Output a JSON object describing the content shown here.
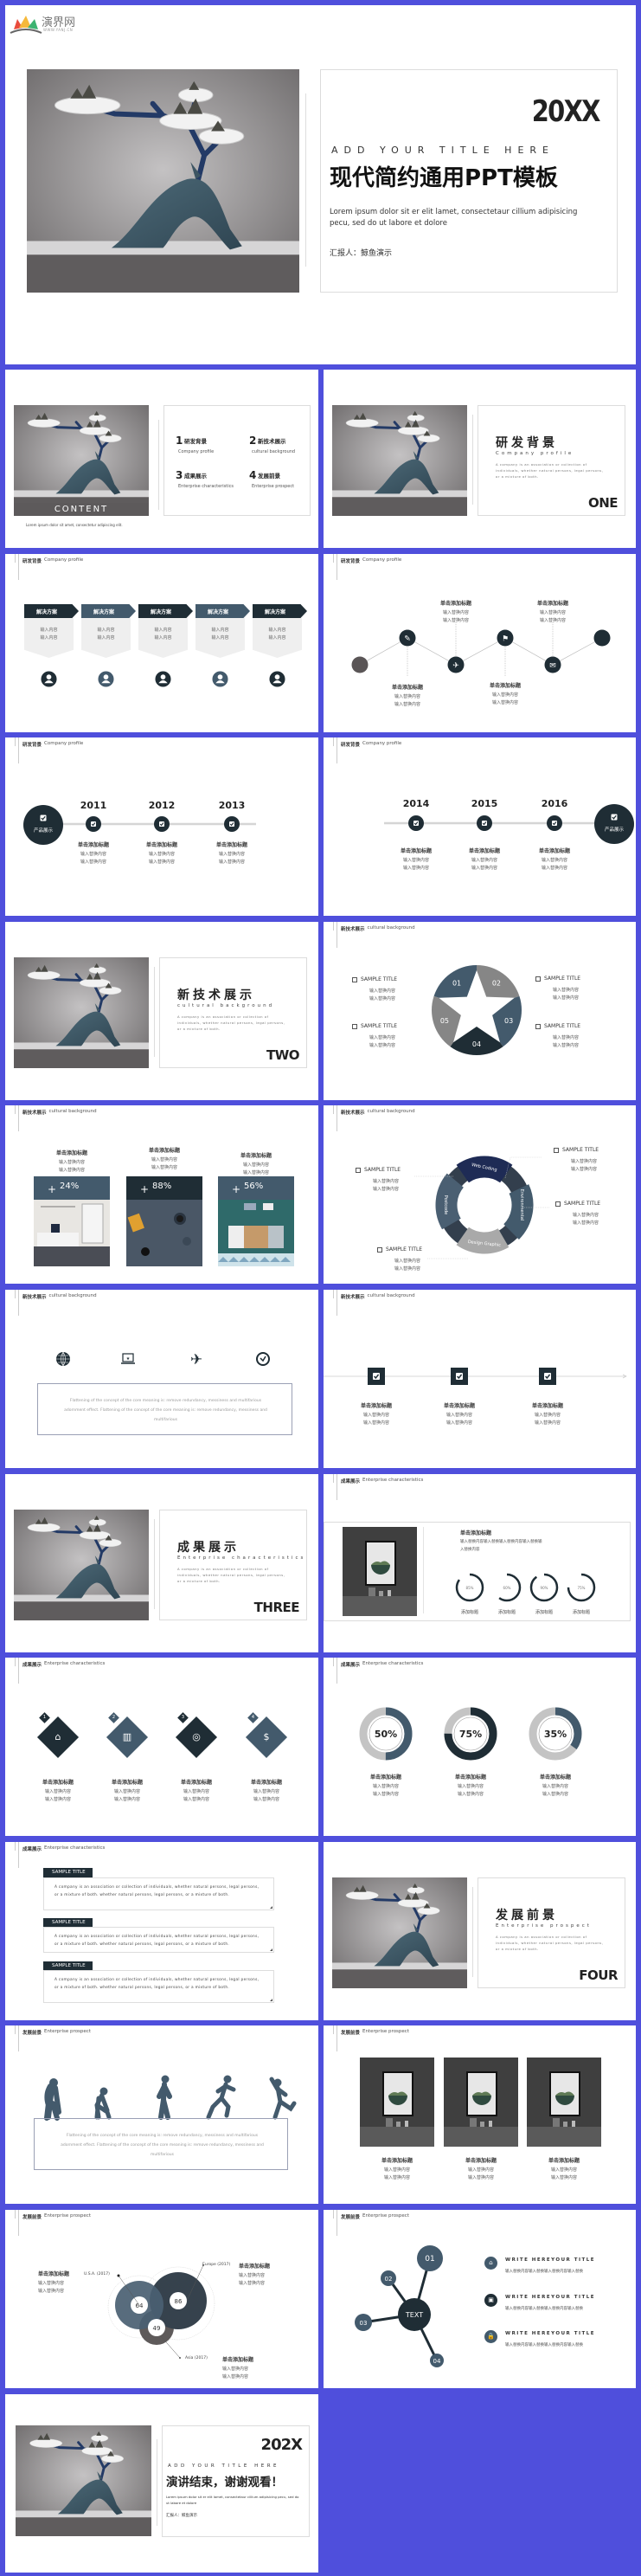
{
  "colors": {
    "background": "#4f4fdc",
    "dark": "#1f2d35",
    "slate": "#435a6c",
    "gray": "#8a8a8a",
    "light": "#efefef"
  },
  "brand": {
    "logo_text": "演界网",
    "logo_sub": "WWW.YANJ.CN"
  },
  "cover": {
    "year": "20XX",
    "en_title": "ADD YOUR TITLE HERE",
    "title": "现代简约通用PPT模板",
    "lorem": "Lorem ipsum dolor sit er elit lamet, consectetaur cillium adipisicing pecu, sed do ut labore et dolore",
    "reporter": "汇报人：鲸鱼演示"
  },
  "slides": [
    {
      "type": "contents",
      "image_caption": "CONTENT",
      "lorem": "Lorem ipsum dolor sit amet, consectetur adipiscing elit.",
      "items": [
        {
          "num": "1",
          "title": "研发背景",
          "sub": "Company profile"
        },
        {
          "num": "2",
          "title": "新技术展示",
          "sub": "cultural background"
        },
        {
          "num": "3",
          "title": "成果展示",
          "sub": "Enterprise characteristics"
        },
        {
          "num": "4",
          "title": "发展前景",
          "sub": "Enterprise prospect"
        }
      ]
    },
    {
      "type": "section",
      "title": "研发背景",
      "subtitle": "Company profile",
      "desc": "A company is an association or collection of individuals, whether natural persons, legal persons, or a mixture of both.",
      "number": "ONE"
    },
    {
      "type": "arrows",
      "header": "研发背景",
      "header_en": "Company profile",
      "boxes": [
        {
          "label": "解决方案",
          "lines": [
            "输入内容",
            "输入内容"
          ]
        },
        {
          "label": "解决方案",
          "lines": [
            "输入内容",
            "输入内容"
          ]
        },
        {
          "label": "解决方案",
          "lines": [
            "输入内容",
            "输入内容"
          ]
        },
        {
          "label": "解决方案",
          "lines": [
            "输入内容",
            "输入内容"
          ]
        },
        {
          "label": "解决方案",
          "lines": [
            "输入内容",
            "输入内容"
          ]
        }
      ]
    },
    {
      "type": "zigzag",
      "header": "研发背景",
      "header_en": "Company profile",
      "icons": [
        "circle",
        "tools-icon",
        "plane-icon",
        "signpost-icon",
        "rocket-icon",
        "circle"
      ],
      "items": [
        {
          "title": "单击添加标题",
          "lines": [
            "输入替换内容",
            "输入替换内容"
          ]
        },
        {
          "title": "单击添加标题",
          "lines": [
            "输入替换内容",
            "输入替换内容"
          ]
        },
        {
          "title": "单击添加标题",
          "lines": [
            "输入替换内容",
            "输入替换内容"
          ]
        },
        {
          "title": "单击添加标题",
          "lines": [
            "输入替换内容",
            "输入替换内容"
          ]
        }
      ]
    },
    {
      "type": "timeline",
      "header": "研发背景",
      "header_en": "Company profile",
      "center_label": "产品展示",
      "side": "left",
      "items": [
        {
          "year": "2011",
          "title": "单击添加标题",
          "lines": [
            "输入替换内容",
            "输入替换内容"
          ]
        },
        {
          "year": "2012",
          "title": "单击添加标题",
          "lines": [
            "输入替换内容",
            "输入替换内容"
          ]
        },
        {
          "year": "2013",
          "title": "单击添加标题",
          "lines": [
            "输入替换内容",
            "输入替换内容"
          ]
        }
      ]
    },
    {
      "type": "timeline",
      "header": "研发背景",
      "header_en": "Company profile",
      "center_label": "产品展示",
      "side": "right",
      "items": [
        {
          "year": "2014",
          "title": "单击添加标题",
          "lines": [
            "输入替换内容",
            "输入替换内容"
          ]
        },
        {
          "year": "2015",
          "title": "单击添加标题",
          "lines": [
            "输入替换内容",
            "输入替换内容"
          ]
        },
        {
          "year": "2016",
          "title": "单击添加标题",
          "lines": [
            "输入替换内容",
            "输入替换内容"
          ]
        }
      ]
    },
    {
      "type": "section",
      "title": "新技术展示",
      "subtitle": "cultural background",
      "desc": "A company is an association or collection of individuals, whether natural persons, legal persons, or a mixture of both.",
      "number": "TWO"
    },
    {
      "type": "star",
      "header": "新技术展示",
      "header_en": "cultural background",
      "segments": [
        "01",
        "02",
        "03",
        "04",
        "05"
      ],
      "items": [
        {
          "title": "SAMPLE TITLE",
          "lines": [
            "输入替换内容",
            "输入替换内容"
          ]
        },
        {
          "title": "SAMPLE TITLE",
          "lines": [
            "输入替换内容",
            "输入替换内容"
          ]
        },
        {
          "title": "SAMPLE TITLE",
          "lines": [
            "输入替换内容",
            "输入替换内容"
          ]
        },
        {
          "title": "SAMPLE TITLE",
          "lines": [
            "输入替换内容",
            "输入替换内容"
          ]
        }
      ]
    },
    {
      "type": "photos",
      "header": "新技术展示",
      "header_en": "cultural background",
      "items": [
        {
          "title": "单击添加标题",
          "lines": [
            "输入替换内容",
            "输入替换内容"
          ],
          "value": "24%"
        },
        {
          "title": "单击添加标题",
          "lines": [
            "输入替换内容",
            "输入替换内容"
          ],
          "value": "88%"
        },
        {
          "title": "单击添加标题",
          "lines": [
            "输入替换内容",
            "输入替换内容"
          ],
          "value": "56%"
        }
      ]
    },
    {
      "type": "ring",
      "header": "新技术展示",
      "header_en": "cultural background",
      "segments": [
        "Web Coding",
        "Environmental",
        "Design Graphic",
        "Postcode"
      ],
      "items": [
        {
          "title": "SAMPLE TITLE",
          "lines": [
            "输入替换内容",
            "输入替换内容"
          ]
        },
        {
          "title": "SAMPLE TITLE",
          "lines": [
            "输入替换内容",
            "输入替换内容"
          ]
        },
        {
          "title": "SAMPLE TITLE",
          "lines": [
            "输入替换内容",
            "输入替换内容"
          ]
        },
        {
          "title": "SAMPLE TITLE",
          "lines": [
            "输入替换内容",
            "输入替换内容"
          ]
        }
      ]
    },
    {
      "type": "iconpara",
      "header": "新技术展示",
      "header_en": "cultural background",
      "icons": [
        "globe-icon",
        "laptop-icon",
        "plane-icon",
        "clock-icon"
      ],
      "paragraph": "Flattening of the concept of the core meaning is: remove redundancy, messiness and multifarious adornment effect. Flattening of the concept of the core meaning is: remove redundancy, messiness and multifarious"
    },
    {
      "type": "checks",
      "header": "新技术展示",
      "header_en": "cultural background",
      "items": [
        {
          "title": "单击添加标题",
          "lines": [
            "输入替换内容",
            "输入替换内容"
          ]
        },
        {
          "title": "单击添加标题",
          "lines": [
            "输入替换内容",
            "输入替换内容"
          ]
        },
        {
          "title": "单击添加标题",
          "lines": [
            "输入替换内容",
            "输入替换内容"
          ]
        }
      ]
    },
    {
      "type": "section",
      "title": "成果展示",
      "subtitle": "Enterprise characteristics",
      "desc": "A company is an association or collection of individuals, whether natural persons, legal persons, or a mixture of both.",
      "number": "THREE"
    },
    {
      "type": "rings",
      "header": "成果展示",
      "header_en": "Enterprise characteristics",
      "title": "单击添加标题",
      "text": "输入替换内容输入替换输入替换内容输入替换输入替换内容",
      "rings": [
        {
          "value": "85%",
          "pct": 85,
          "label": "添加标题"
        },
        {
          "value": "60%",
          "pct": 60,
          "label": "添加标题"
        },
        {
          "value": "90%",
          "pct": 90,
          "label": "添加标题"
        },
        {
          "value": "75%",
          "pct": 75,
          "label": "添加标题"
        }
      ]
    },
    {
      "type": "diamonds",
      "header": "成果展示",
      "header_en": "Enterprise characteristics",
      "items": [
        {
          "num": "1",
          "icon": "home-icon",
          "title": "单击添加标题",
          "lines": [
            "输入替换内容",
            "输入替换内容"
          ]
        },
        {
          "num": "2",
          "icon": "chart-icon",
          "title": "单击添加标题",
          "lines": [
            "输入替换内容",
            "输入替换内容"
          ]
        },
        {
          "num": "3",
          "icon": "target-icon",
          "title": "单击添加标题",
          "lines": [
            "输入替换内容",
            "输入替换内容"
          ]
        },
        {
          "num": "4",
          "icon": "money-bag-icon",
          "title": "单击添加标题",
          "lines": [
            "输入替换内容",
            "输入替换内容"
          ]
        }
      ]
    },
    {
      "type": "donuts",
      "header": "成果展示",
      "header_en": "Enterprise characteristics",
      "items": [
        {
          "value": "50%",
          "pct": 50,
          "title": "单击添加标题",
          "lines": [
            "输入替换内容",
            "输入替换内容"
          ]
        },
        {
          "value": "75%",
          "pct": 75,
          "title": "单击添加标题",
          "lines": [
            "输入替换内容",
            "输入替换内容"
          ]
        },
        {
          "value": "35%",
          "pct": 35,
          "title": "单击添加标题",
          "lines": [
            "输入替换内容",
            "输入替换内容"
          ]
        }
      ]
    },
    {
      "type": "textboxes",
      "header": "成果展示",
      "header_en": "Enterprise characteristics",
      "items": [
        {
          "title": "SAMPLE TITLE",
          "text": "A company is an association or collection of individuals, whether natural persons, legal persons, or a mixture of both. whether natural persons, legal persons, or a mixture of both."
        },
        {
          "title": "SAMPLE TITLE",
          "text": "A company is an association or collection of individuals, whether natural persons, legal persons, or a mixture of both. whether natural persons, legal persons, or a mixture of both."
        },
        {
          "title": "SAMPLE TITLE",
          "text": "A company is an association or collection of individuals, whether natural persons, legal persons, or a mixture of both. whether natural persons, legal persons, or a mixture of both."
        }
      ]
    },
    {
      "type": "section",
      "title": "发展前景",
      "subtitle": "Enterprise prospect",
      "desc": "A company is an association or collection of individuals, whether natural persons, legal persons, or a mixture of both.",
      "number": "FOUR"
    },
    {
      "type": "runners",
      "header": "发展前景",
      "header_en": "Enterprise prospect",
      "paragraph": "Flattening of the concept of the core meaning is: remove redundancy, messiness and multifarious adornment effect. Flattening of the concept of the core meaning is: remove redundancy, messiness and multifarious"
    },
    {
      "type": "frames",
      "header": "发展前景",
      "header_en": "Enterprise prospect",
      "items": [
        {
          "title": "单击添加标题",
          "lines": [
            "输入替换内容",
            "输入替换内容"
          ]
        },
        {
          "title": "单击添加标题",
          "lines": [
            "输入替换内容",
            "输入替换内容"
          ]
        },
        {
          "title": "单击添加标题",
          "lines": [
            "输入替换内容",
            "输入替换内容"
          ]
        }
      ]
    },
    {
      "type": "venn",
      "header": "发展前景",
      "header_en": "Enterprise prospect",
      "circles": [
        {
          "label": "U.S.A. (2017)",
          "value": "64"
        },
        {
          "label": "Europe (2017)",
          "value": "86"
        },
        {
          "label": "Asia (2017)",
          "value": "49"
        }
      ],
      "items": [
        {
          "title": "单击添加标题",
          "lines": [
            "输入替换内容",
            "输入替换内容"
          ]
        },
        {
          "title": "单击添加标题",
          "lines": [
            "输入替换内容",
            "输入替换内容"
          ]
        },
        {
          "title": "单击添加标题",
          "lines": [
            "输入替换内容",
            "输入替换内容"
          ]
        }
      ]
    },
    {
      "type": "network",
      "header": "发展前景",
      "header_en": "Enterprise prospect",
      "center": "TEXT",
      "nodes": [
        "01",
        "02",
        "03",
        "04"
      ],
      "items": [
        {
          "icon": "home-icon",
          "title": "WRITE HEREYOUR TITLE",
          "text": "输入替换内容输入替换输入替换内容输入替换"
        },
        {
          "icon": "briefcase-icon",
          "title": "WRITE HEREYOUR TITLE",
          "text": "输入替换内容输入替换输入替换内容输入替换"
        },
        {
          "icon": "lock-icon",
          "title": "WRITE HEREYOUR TITLE",
          "text": "输入替换内容输入替换输入替换内容输入替换"
        }
      ]
    },
    {
      "type": "end",
      "year": "202X",
      "en_title": "ADD YOUR TITLE HERE",
      "title": "演讲结束，谢谢观看！",
      "lorem": "Lorem ipsum dolor sit er elit lamet, consectetaur cillium adipisicing pecu, sed do ut labore et dolore",
      "reporter": "汇报人：鲸鱼演示"
    }
  ]
}
